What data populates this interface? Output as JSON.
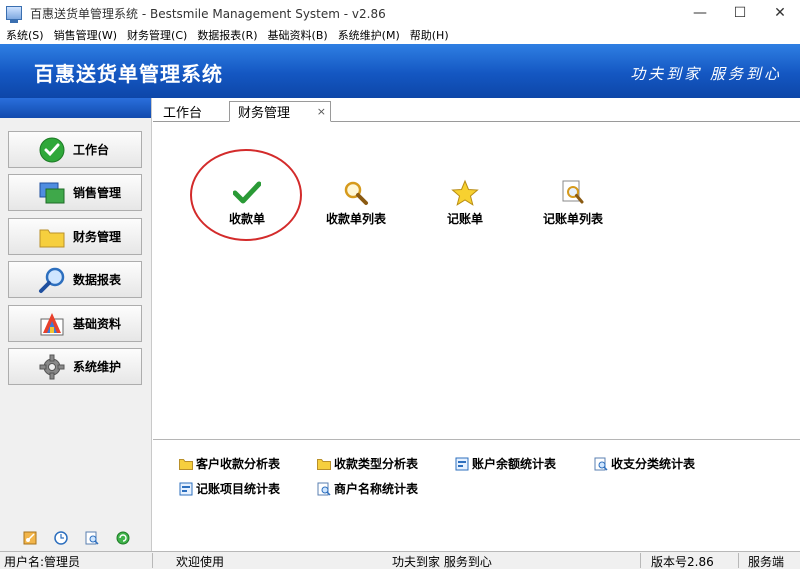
{
  "window": {
    "title": "百惠送货单管理系统 - Bestsmile Management System - v2.86",
    "minimize": "—",
    "maximize": "☐",
    "close": "✕"
  },
  "menu": [
    "系统(S)",
    "销售管理(W)",
    "财务管理(C)",
    "数据报表(R)",
    "基础资料(B)",
    "系统维护(M)",
    "帮助(H)"
  ],
  "banner": {
    "title": "百惠送货单管理系统",
    "slogan": "功夫到家 服务到心"
  },
  "sidebar": {
    "items": [
      {
        "label": "工作台",
        "icon": "check-circle-icon"
      },
      {
        "label": "销售管理",
        "icon": "windows-icon"
      },
      {
        "label": "财务管理",
        "icon": "folder-icon"
      },
      {
        "label": "数据报表",
        "icon": "magnifier-icon"
      },
      {
        "label": "基础资料",
        "icon": "palette-icon"
      },
      {
        "label": "系统维护",
        "icon": "gear-icon"
      }
    ],
    "footer_icons": [
      "key-icon",
      "clock-icon",
      "search-doc-icon",
      "refresh-icon"
    ]
  },
  "tabs": [
    {
      "label": "工作台",
      "active": false
    },
    {
      "label": "财务管理",
      "active": true,
      "close": "×"
    }
  ],
  "functions": [
    {
      "label": "收款单",
      "icon": "checkmark-icon",
      "highlighted": true
    },
    {
      "label": "收款单列表",
      "icon": "magnifier-icon"
    },
    {
      "label": "记账单",
      "icon": "star-icon"
    },
    {
      "label": "记账单列表",
      "icon": "search-doc-icon"
    }
  ],
  "reports": [
    {
      "label": "客户收款分析表",
      "icon": "folder-icon"
    },
    {
      "label": "收款类型分析表",
      "icon": "folder-icon"
    },
    {
      "label": "账户余额统计表",
      "icon": "report-icon"
    },
    {
      "label": "收支分类统计表",
      "icon": "search-doc-icon"
    },
    {
      "label": "记账项目统计表",
      "icon": "report-icon"
    },
    {
      "label": "商户名称统计表",
      "icon": "search-doc-icon"
    }
  ],
  "status": {
    "user": "用户名:管理员",
    "welcome": "欢迎使用",
    "slogan": "功夫到家 服务到心",
    "version": "版本号2.86",
    "client": "服务端"
  },
  "colors": {
    "banner_top": "#2f7fe3",
    "banner_bottom": "#0d46a8",
    "highlight_ring": "#d32b2b"
  }
}
